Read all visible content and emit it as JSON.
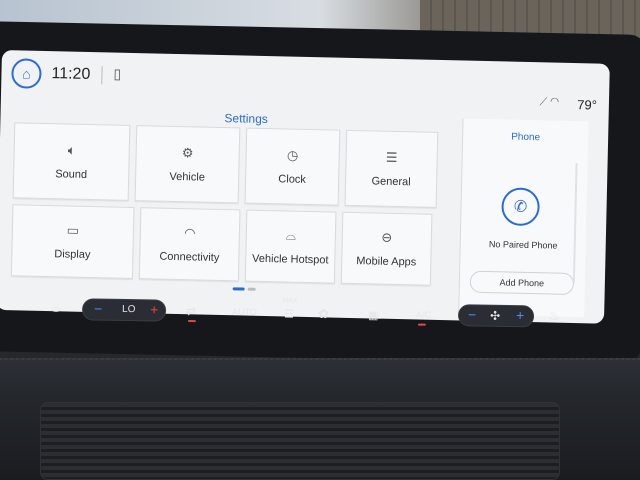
{
  "status": {
    "time": "11:20",
    "temperature": "79°"
  },
  "settings": {
    "title": "Settings",
    "tiles": [
      {
        "label": "Sound"
      },
      {
        "label": "Vehicle"
      },
      {
        "label": "Clock"
      },
      {
        "label": "General"
      },
      {
        "label": "Display"
      },
      {
        "label": "Connectivity"
      },
      {
        "label": "Vehicle Hotspot"
      },
      {
        "label": "Mobile Apps"
      }
    ]
  },
  "phone_panel": {
    "title": "Phone",
    "status": "No Paired Phone",
    "add_label": "Add Phone"
  },
  "climate": {
    "minus": "−",
    "plus": "+",
    "temp_setting": "LO",
    "auto_label": "AUTO",
    "max_label": "MAX",
    "ac_label": "A/C"
  },
  "icons": {
    "home": "home-icon",
    "phone": "phone-icon",
    "sound": "speaker-icon",
    "vehicle": "vehicle-settings-icon",
    "clock": "clock-icon",
    "general": "sliders-icon",
    "display": "display-icon",
    "connectivity": "wifi-icon",
    "hotspot": "hotspot-icon",
    "mobile_apps": "link-icon"
  },
  "colors": {
    "accent": "#2c6bd6",
    "heat": "#e04848",
    "cool": "#4f8df0"
  }
}
